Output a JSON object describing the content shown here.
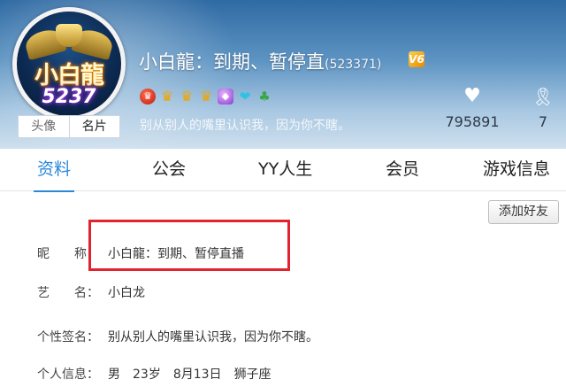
{
  "profile": {
    "avatar_text": "小白龍",
    "avatar_number": "5237",
    "nickname": "小白龍：到期、暂停直",
    "uid": "(523371)",
    "vip_badge": "V6",
    "signature": "别从别人的嘴里认识我，因为你不瞎。"
  },
  "avatar_tabs": {
    "avatar": "头像",
    "card": "名片"
  },
  "badges": [
    {
      "icon": "red-medal-icon",
      "glyph": "♛"
    },
    {
      "icon": "crown-icon",
      "glyph": "♛"
    },
    {
      "icon": "crown-icon",
      "glyph": "♛"
    },
    {
      "icon": "crown-icon",
      "glyph": "♛"
    },
    {
      "icon": "purple-gem-icon",
      "glyph": "◆"
    },
    {
      "icon": "cyan-heart-icon",
      "glyph": "❤"
    },
    {
      "icon": "green-leaf-icon",
      "glyph": "♣"
    }
  ],
  "stats": {
    "likes": {
      "icon": "heart-icon",
      "value": "795891"
    },
    "fans": {
      "icon": "ribbon-icon",
      "value": "7"
    }
  },
  "tabs": {
    "data": "资料",
    "guild": "公会",
    "life": "YY人生",
    "vip": "会员",
    "game": "游戏信息"
  },
  "actions": {
    "add_friend": "添加好友"
  },
  "details": {
    "nickname_label": "昵　　称：",
    "nickname_value": "小白龍：到期、暂停直播",
    "artname_label": "艺　　名：",
    "artname_value": "小白龙",
    "signature_label": "个性签名：",
    "signature_value": "别从别人的嘴里认识我，因为你不瞎。",
    "info_label": "个人信息：",
    "gender": "男",
    "age": "23岁",
    "birthday": "8月13日",
    "zodiac": "狮子座"
  },
  "colors": {
    "accent": "#2b88d8",
    "highlight": "#e2232f"
  }
}
